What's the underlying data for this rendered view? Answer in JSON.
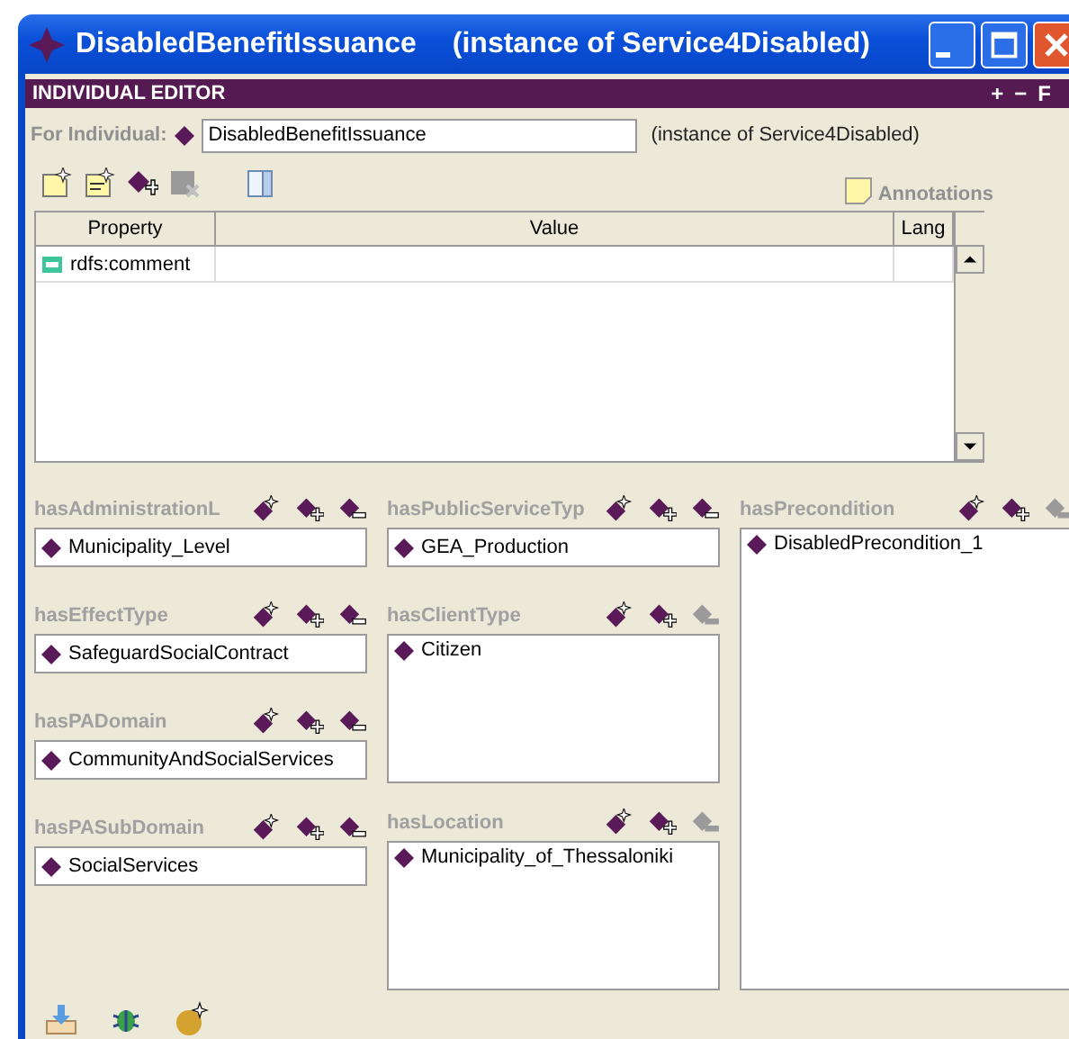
{
  "window": {
    "title": "DisabledBenefitIssuance",
    "subtitle": "(instance of Service4Disabled)"
  },
  "editor": {
    "header": "INDIVIDUAL EDITOR",
    "header_buttons": [
      "+",
      "−",
      "F"
    ],
    "individual_label": "For Individual:",
    "individual_value": "DisabledBenefitIssuance",
    "individual_type": "(instance of Service4Disabled)",
    "toolbar": [
      {
        "kind": "new-note",
        "disabled": false
      },
      {
        "kind": "new-doc",
        "disabled": false
      },
      {
        "kind": "add",
        "disabled": false
      },
      {
        "kind": "delete",
        "disabled": true
      },
      {
        "kind": "panel",
        "disabled": false
      }
    ],
    "annotations": "Annotations"
  },
  "table": {
    "columns": [
      "Property",
      "Value",
      "Lang"
    ],
    "rows": [
      {
        "property": "rdfs:comment"
      }
    ]
  },
  "columns": [
    [
      {
        "label": "hasAdministrationL",
        "kind": "single",
        "remove_enabled": true,
        "values": [
          "Municipality_Level"
        ]
      },
      {
        "label": "hasEffectType",
        "kind": "single",
        "remove_enabled": true,
        "values": [
          "SafeguardSocialContract"
        ]
      },
      {
        "label": "hasPADomain",
        "kind": "single",
        "remove_enabled": true,
        "values": [
          "CommunityAndSocialServices"
        ]
      },
      {
        "label": "hasPASubDomain",
        "kind": "single",
        "remove_enabled": true,
        "values": [
          "SocialServices"
        ]
      }
    ],
    [
      {
        "label": "hasPublicServiceTyp",
        "kind": "single",
        "remove_enabled": true,
        "values": [
          "GEA_Production"
        ]
      },
      {
        "label": "hasClientType",
        "kind": "list",
        "remove_enabled": false,
        "values": [
          "Citizen"
        ]
      },
      {
        "label": "hasLocation",
        "kind": "list",
        "remove_enabled": false,
        "values": [
          "Municipality_of_Thessaloniki"
        ]
      }
    ],
    [
      {
        "label": "hasPrecondition",
        "kind": "list",
        "remove_enabled": false,
        "values": [
          "DisabledPrecondition_1"
        ]
      }
    ]
  ]
}
